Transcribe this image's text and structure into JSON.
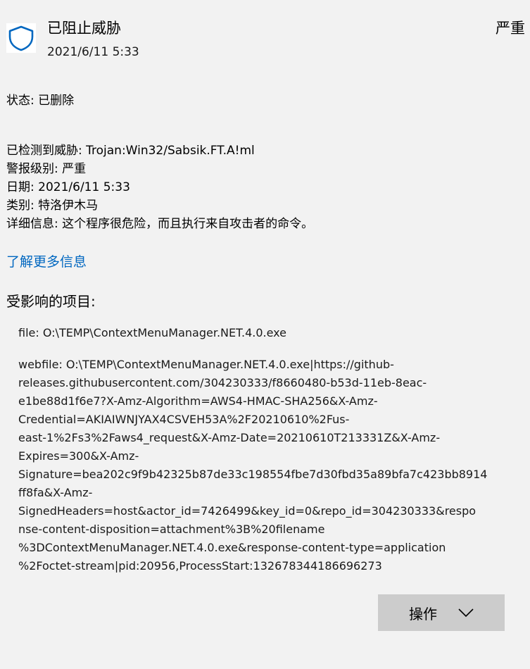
{
  "header": {
    "title": "已阻止威胁",
    "date": "2021/6/11 5:33",
    "severity": "严重",
    "icon": "shield-icon",
    "accent_color": "#0067c0"
  },
  "status": {
    "label": "状态:",
    "value": "已删除"
  },
  "details": [
    {
      "label": "已检测到威胁:",
      "value": "Trojan:Win32/Sabsik.FT.A!ml"
    },
    {
      "label": "警报级别:",
      "value": "严重"
    },
    {
      "label": "日期:",
      "value": "2021/6/11 5:33"
    },
    {
      "label": "类别:",
      "value": "特洛伊木马"
    },
    {
      "label": "详细信息:",
      "value": "这个程序很危险，而且执行来自攻击者的命令。"
    }
  ],
  "learn_more_link": "了解更多信息",
  "affected": {
    "heading": "受影响的项目:",
    "file": "file: O:\\TEMP\\ContextMenuManager.NET.4.0.exe",
    "webfile_lines": [
      "webfile: O:\\TEMP\\ContextMenuManager.NET.4.0.exe|https://github-",
      "releases.githubusercontent.com/304230333/f8660480-b53d-11eb-8eac-",
      "e1be88d1f6e7?X-Amz-Algorithm=AWS4-HMAC-SHA256&X-Amz-",
      "Credential=AKIAIWNJYAX4CSVEH53A%2F20210610%2Fus-",
      "east-1%2Fs3%2Faws4_request&X-Amz-Date=20210610T213331Z&X-Amz-",
      "Expires=300&X-Amz-",
      "Signature=bea202c9f9b42325b87de33c198554fbe7d30fbd35a89bfa7c423bb8914",
      "ff8fa&X-Amz-",
      "SignedHeaders=host&actor_id=7426499&key_id=0&repo_id=304230333&respo",
      "nse-content-disposition=attachment%3B%20filename",
      "%3DContextMenuManager.NET.4.0.exe&response-content-type=application",
      "%2Foctet-stream|pid:20956,ProcessStart:132678344186696273"
    ]
  },
  "actions": {
    "button_label": "操作",
    "icon": "chevron-down-icon"
  }
}
